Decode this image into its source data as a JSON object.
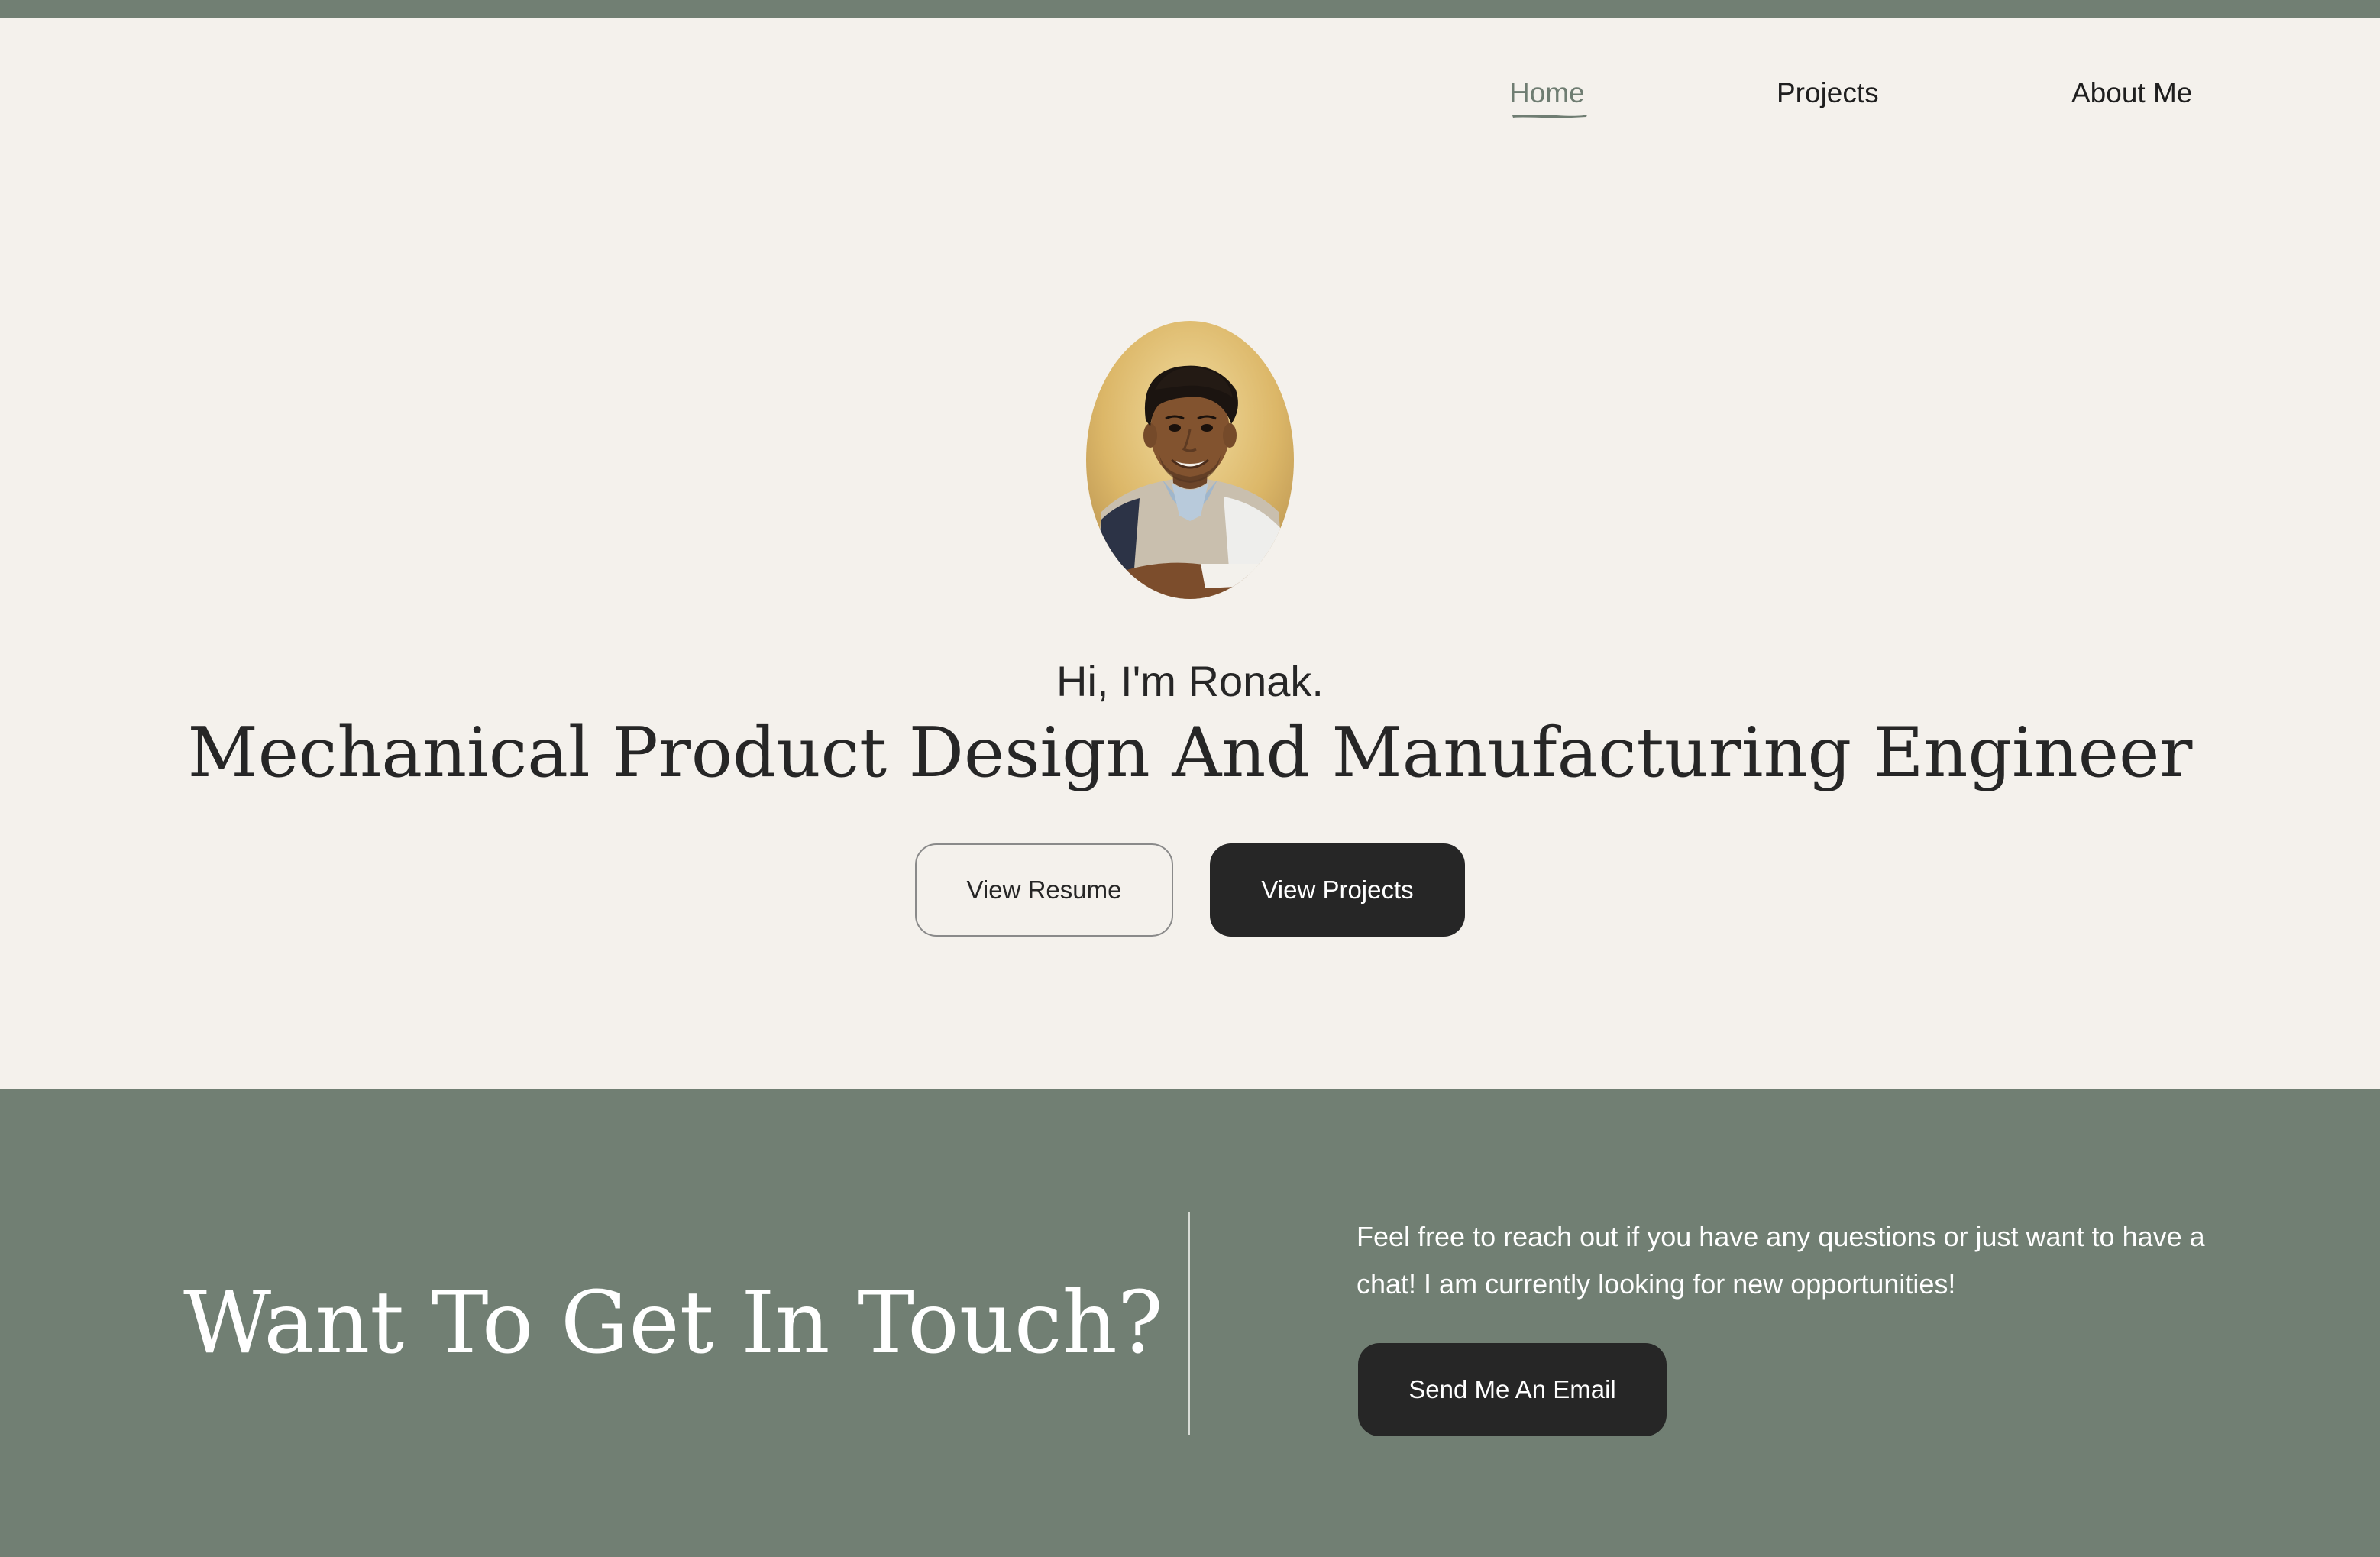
{
  "nav": {
    "items": [
      {
        "label": "Home",
        "active": true
      },
      {
        "label": "Projects",
        "active": false
      },
      {
        "label": "About Me",
        "active": false
      }
    ]
  },
  "hero": {
    "greeting": "Hi, I'm Ronak.",
    "headline": "Mechanical Product Design And Manufacturing Engineer",
    "buttons": {
      "resume": "View Resume",
      "projects": "View Projects"
    }
  },
  "contact": {
    "title": "Want To Get In Touch?",
    "text": "Feel free to reach out if you have any questions or just want to have a chat! I am currently looking for new opportunities!",
    "button": "Send Me An Email"
  },
  "colors": {
    "background": "#f4f1ec",
    "accent_green": "#717f73",
    "dark": "#262626"
  }
}
